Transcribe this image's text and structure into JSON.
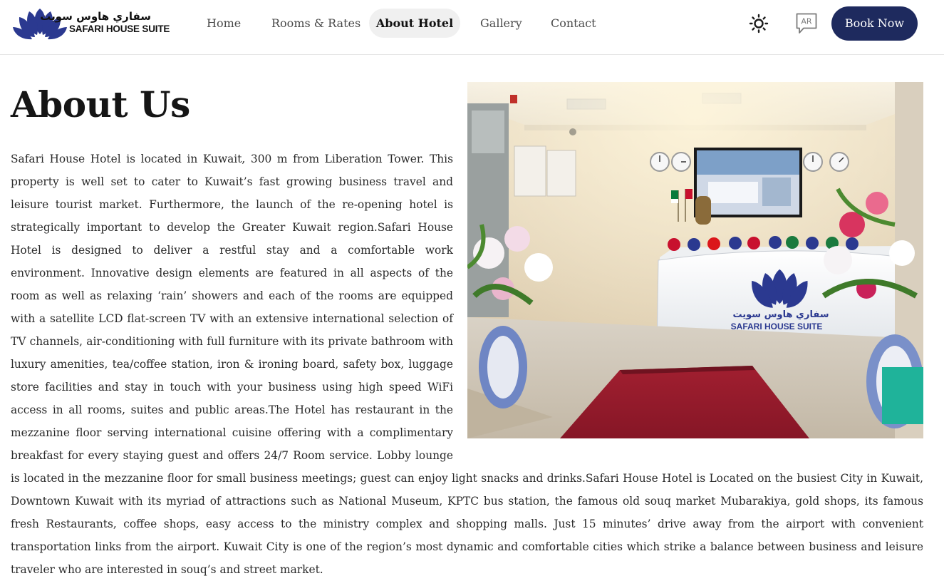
{
  "brand": {
    "name_ar": "سفاري هاوس سويت",
    "name_en": "SAFARI HOUSE SUITE"
  },
  "nav": {
    "items": [
      {
        "label": "Home"
      },
      {
        "label": "Rooms & Rates"
      },
      {
        "label": "About Hotel",
        "active": true
      },
      {
        "label": "Gallery"
      },
      {
        "label": "Contact"
      }
    ]
  },
  "header": {
    "theme_icon": "sun-icon",
    "language_label": "AR",
    "book_label": "Book Now"
  },
  "about": {
    "title": "About Us",
    "body": "Safari House Hotel is located in Kuwait, 300 m from Liberation Tower. This property is well set to cater to Kuwait’s fast growing business travel and leisure tourist market. Furthermore, the launch of the re-opening hotel is strategically important to develop the Greater Kuwait region.Safari House Hotel is designed to deliver a restful stay and a comfortable work environment. Innovative design elements are featured in all aspects of the room as well as relaxing ‘rain’ showers and each of the rooms are equipped with a satellite LCD flat-screen TV with an extensive international selection of TV channels, air-conditioning with full furniture with its private bathroom with luxury amenities, tea/coffee station, iron & ironing board, safety box, luggage store facilities and stay in touch with your business using high speed WiFi access in all rooms, suites and public areas.The Hotel has restaurant in the mezzanine floor serving international cuisine offering with a complimentary breakfast for every staying guest and offers 24/7 Room service. Lobby lounge is located in the mezzanine floor for small business meetings; guest can enjoy light snacks and drinks.Safari House Hotel is Located on the busiest City in Kuwait, Downtown Kuwait with its myriad of attractions such as National Museum, KPTC bus station, the famous old souq market Mubarakiya, gold shops, its famous fresh Restaurants, coffee shops, easy access to the ministry complex and shopping malls. Just 15 minutes’ drive away from the airport with convenient transportation links from the airport. Kuwait City is one of the region’s most dynamic and comfortable cities which strike a balance between business and leisure traveler who are interested in souq’s and street market."
  },
  "reception_sign": {
    "name_ar": "سفاري هاوس سويت",
    "name_en": "SAFARI HOUSE SUITE"
  },
  "colors": {
    "brand_navy": "#1e2a5e",
    "logo_blue": "#2b3990",
    "carpet_red": "#9c1c2c"
  }
}
